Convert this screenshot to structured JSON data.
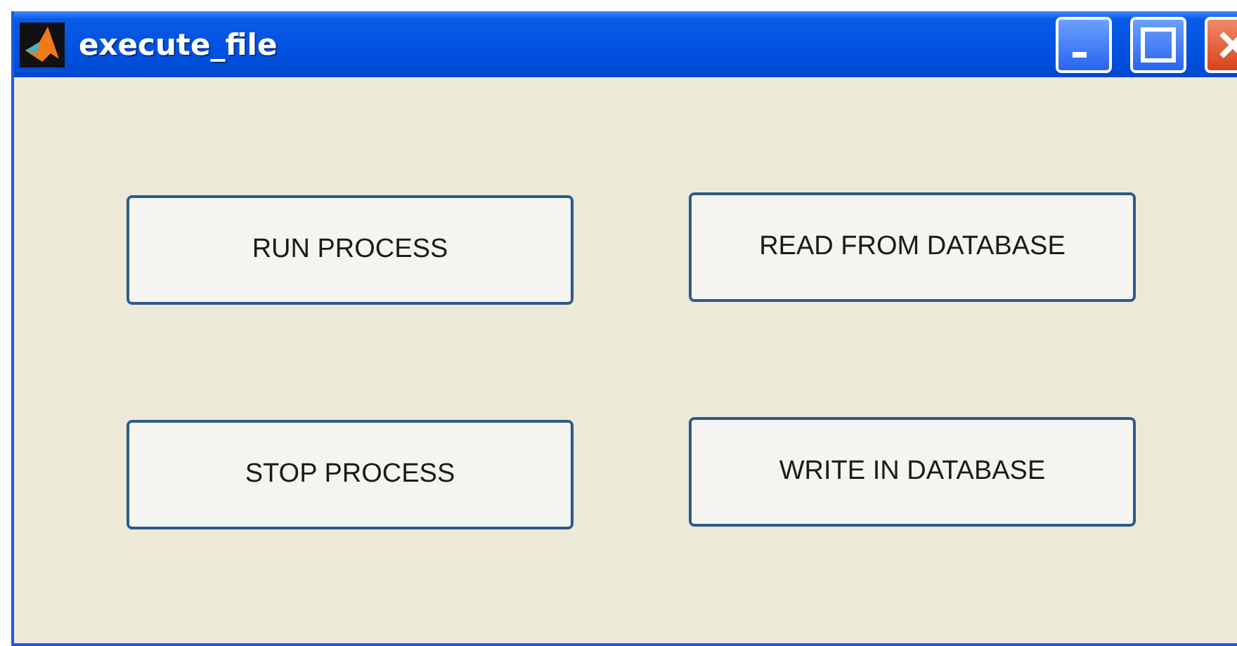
{
  "window": {
    "title": "execute_file"
  },
  "buttons": [
    {
      "label": "RUN PROCESS"
    },
    {
      "label": "READ FROM DATABASE"
    },
    {
      "label": "STOP PROCESS"
    },
    {
      "label": "WRITE IN DATABASE"
    }
  ]
}
